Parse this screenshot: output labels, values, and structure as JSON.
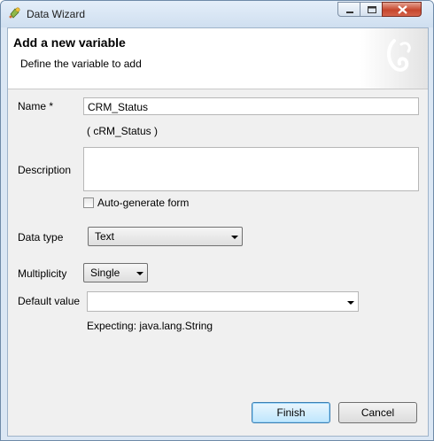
{
  "window": {
    "title": "Data Wizard"
  },
  "banner": {
    "title": "Add a new variable",
    "subtitle": "Define the variable to add"
  },
  "form": {
    "name_label": "Name *",
    "name_value": "CRM_Status",
    "name_hint": "( cRM_Status )",
    "description_label": "Description",
    "description_value": "",
    "autogen_label": "Auto-generate form",
    "autogen_checked": false,
    "datatype_label": "Data type",
    "datatype_value": "Text",
    "multiplicity_label": "Multiplicity",
    "multiplicity_value": "Single",
    "default_label": "Default value",
    "default_value": "",
    "expecting_text": "Expecting: java.lang.String"
  },
  "buttons": {
    "finish": "Finish",
    "cancel": "Cancel"
  },
  "icons": {
    "app": "wizard-icon",
    "minimize": "minimize-icon",
    "maximize": "maximize-icon",
    "close": "close-icon",
    "logo": "bonita-logo-icon",
    "dropdown": "chevron-down-icon"
  },
  "colors": {
    "close_button": "#c6462d",
    "default_button": "#3c7fb1"
  }
}
